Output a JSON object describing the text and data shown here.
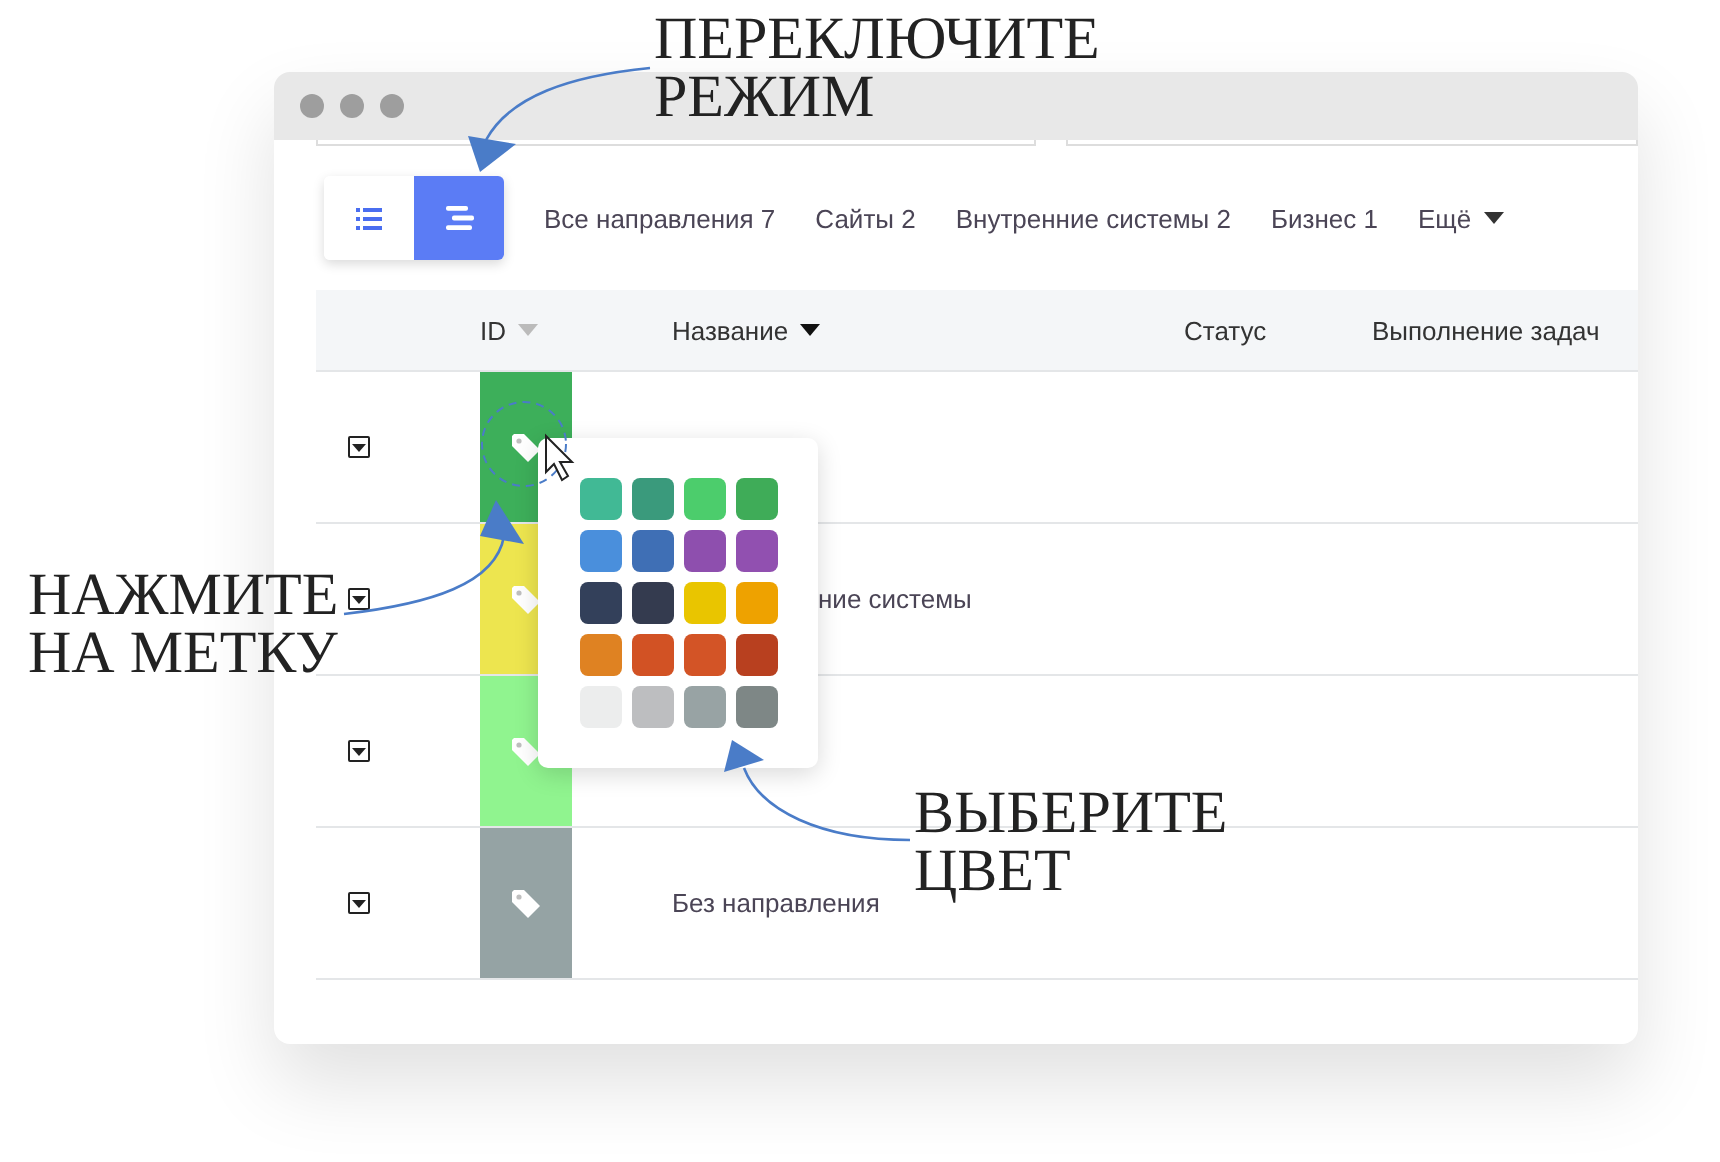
{
  "view_modes": [
    {
      "kind": "list",
      "selected": false
    },
    {
      "kind": "compact",
      "selected": true
    }
  ],
  "filters": [
    {
      "label": "Все направления 7"
    },
    {
      "label": "Сайты 2"
    },
    {
      "label": "Внутренние системы 2"
    },
    {
      "label": "Бизнес 1"
    },
    {
      "label": "Ещё",
      "kind": "more"
    }
  ],
  "table": {
    "columns": [
      {
        "label": "ID",
        "sorted": false
      },
      {
        "label": "Название",
        "sorted": true
      },
      {
        "label": "Статус"
      },
      {
        "label": "Выполнение задач"
      }
    ],
    "rows": [
      {
        "color": "#3daf5a"
      },
      {
        "name": "ние системы",
        "kind": "partly_hidden",
        "color": "#ede54f"
      },
      {
        "color": "#90f48f"
      },
      {
        "name": "Без направления",
        "color": "#95a3a4"
      }
    ]
  },
  "color_picker": {
    "swatches": [
      {
        "color": "#41b995"
      },
      {
        "color": "#3a9a7c"
      },
      {
        "color": "#4ccd6c"
      },
      {
        "color": "#3fac58"
      },
      {
        "color": "#4a8fdc"
      },
      {
        "color": "#3f6fb5"
      },
      {
        "color": "#8e4fae"
      },
      {
        "color": "#9150b0"
      },
      {
        "color": "#33405a"
      },
      {
        "color": "#343b4f"
      },
      {
        "color": "#e9c500"
      },
      {
        "color": "#eea200"
      },
      {
        "color": "#df8222"
      },
      {
        "color": "#d25224"
      },
      {
        "color": "#d35426"
      },
      {
        "color": "#b8401f"
      },
      {
        "color": "#eceded"
      },
      {
        "color": "#bdbec0"
      },
      {
        "color": "#98a3a4"
      },
      {
        "color": "#7e8786"
      }
    ]
  },
  "annotations": [
    {
      "text": "ПЕРЕКЛЮЧИТЕ\nРЕЖИМ"
    },
    {
      "text": "НАЖМИТЕ\nНА МЕТКУ"
    },
    {
      "text": "ВЫБЕРИТЕ\nЦВЕТ"
    }
  ]
}
